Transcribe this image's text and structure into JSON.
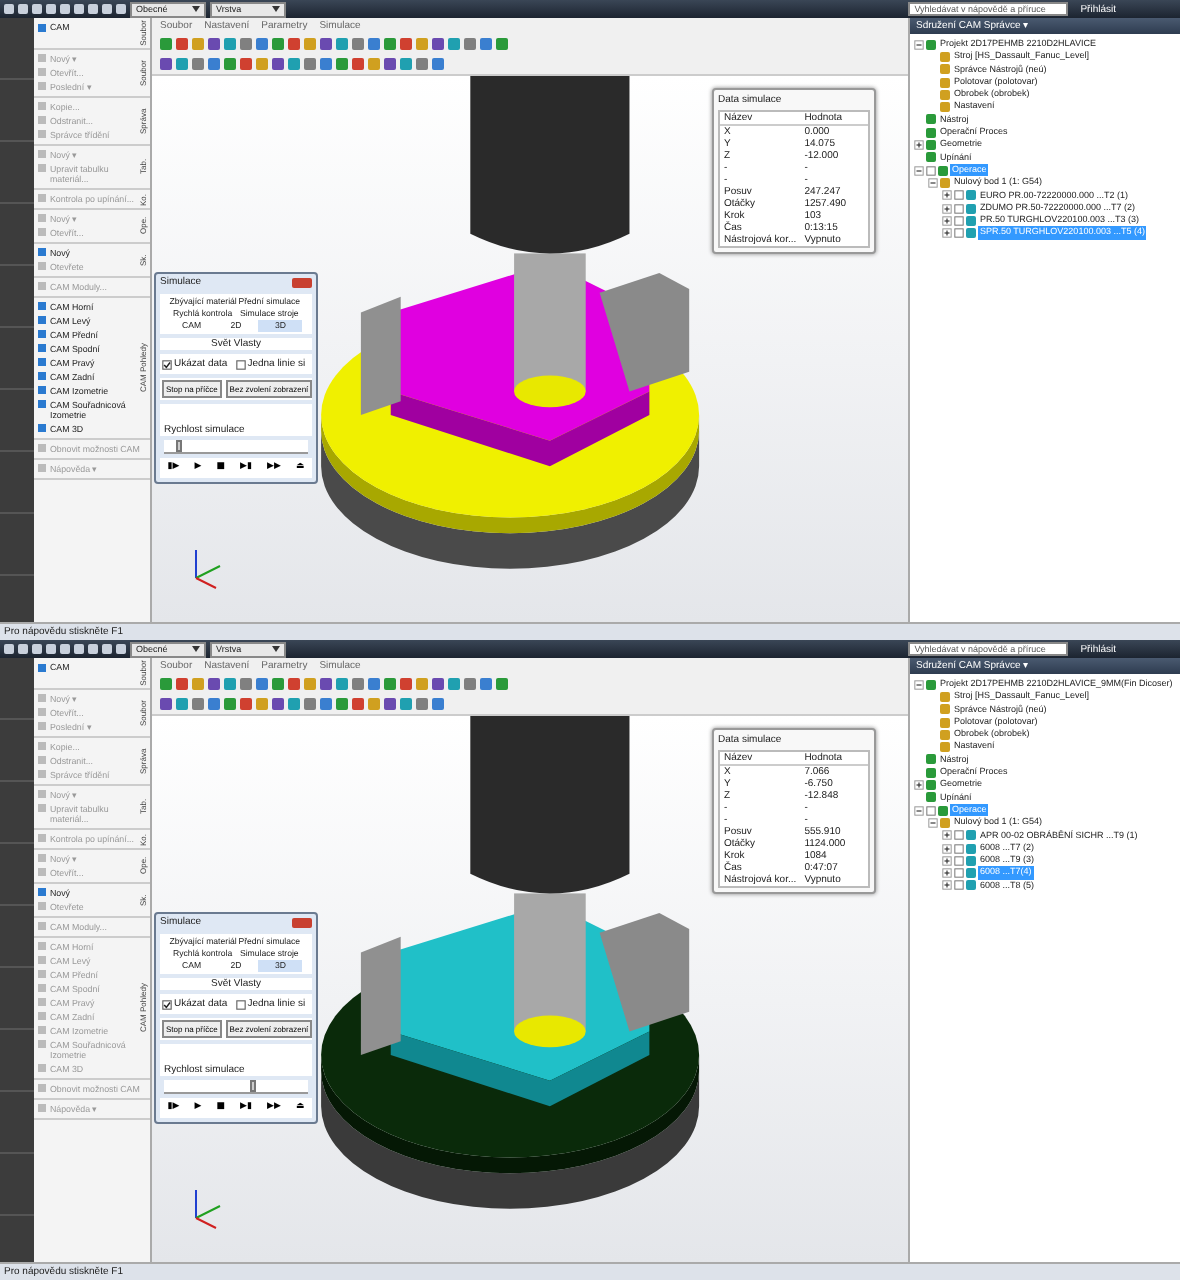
{
  "panes": [
    {
      "title_bar": {
        "search": {
          "placeholder": "Vyhledávat v nápovědě a příruce"
        },
        "sign_in": "Přihlásit",
        "dropdowns": [
          "Obecné",
          "Vrstva"
        ]
      },
      "ribbon": [
        {
          "label": "Soubor",
          "items": [
            {
              "label": "CAM",
              "disabled": false
            }
          ]
        },
        {
          "label": "Soubor",
          "items": [
            {
              "label": "Nový ▾",
              "disabled": true
            },
            {
              "label": "Otevřít...",
              "disabled": true
            },
            {
              "label": "Poslední ▾",
              "disabled": true
            }
          ]
        },
        {
          "label": "Správa",
          "items": [
            {
              "label": "Kopie...",
              "disabled": true
            },
            {
              "label": "Odstranit...",
              "disabled": true
            },
            {
              "label": "Správce třídění",
              "disabled": true
            }
          ]
        },
        {
          "label": "Tab.",
          "items": [
            {
              "label": "Nový ▾",
              "disabled": true
            },
            {
              "label": "Upravit tabulku materiál...",
              "disabled": true
            }
          ]
        },
        {
          "label": "Ko.",
          "items": [
            {
              "label": "Kontrola po upínání...",
              "disabled": true
            }
          ]
        },
        {
          "label": "Ope.",
          "items": [
            {
              "label": "Nový ▾",
              "disabled": true
            },
            {
              "label": "Otevřít...",
              "disabled": true
            }
          ]
        },
        {
          "label": "Sk.",
          "items": [
            {
              "label": "Nový",
              "disabled": false
            },
            {
              "label": "Otevřete",
              "disabled": true
            }
          ]
        },
        {
          "items": [
            {
              "label": "CAM Moduly...",
              "disabled": true
            }
          ]
        },
        {
          "label": "CAM Pohledy",
          "items": [
            {
              "label": "CAM Horní",
              "disabled": false
            },
            {
              "label": "CAM Levý",
              "disabled": false
            },
            {
              "label": "CAM Přední",
              "disabled": false
            },
            {
              "label": "CAM Spodní",
              "disabled": false
            },
            {
              "label": "CAM Pravý",
              "disabled": false
            },
            {
              "label": "CAM Zadní",
              "disabled": false
            },
            {
              "label": "CAM Izometrie",
              "disabled": false
            },
            {
              "label": "CAM Souřadnicová Izometrie",
              "disabled": false
            },
            {
              "label": "CAM 3D",
              "disabled": false
            }
          ]
        },
        {
          "items": [
            {
              "label": "Obnovit možnosti CAM",
              "disabled": true
            }
          ]
        },
        {
          "items": [
            {
              "label": "Nápověda ▾",
              "disabled": true
            }
          ]
        }
      ],
      "menu": [
        "Soubor",
        "Nastavení",
        "Parametry",
        "Simulace"
      ],
      "data_panel": {
        "title": "Data simulace",
        "columns": [
          "Název",
          "Hodnota"
        ],
        "rows": [
          [
            "X",
            "0.000"
          ],
          [
            "Y",
            "14.075"
          ],
          [
            "Z",
            "-12.000"
          ],
          [
            "-",
            "-"
          ],
          [
            "-",
            "-"
          ],
          [
            "Posuv",
            "247.247"
          ],
          [
            "Otáčky",
            "1257.490"
          ],
          [
            "Krok",
            "103"
          ],
          [
            "Čas",
            "0:13:15"
          ],
          [
            "Nástrojová kor...",
            "Vypnuto"
          ]
        ]
      },
      "simulation": {
        "title": "Simulace",
        "tabs": [
          {
            "label": "Zbývající materiál",
            "selected": false
          },
          {
            "label": "Přední simulace",
            "selected": false
          },
          {
            "label": "Rychlá kontrola",
            "selected": false
          },
          {
            "label": "Simulace stroje",
            "selected": false
          },
          {
            "label": "CAM",
            "selected": false
          },
          {
            "label": "2D",
            "selected": false
          },
          {
            "label": "3D",
            "selected": true
          }
        ],
        "subtitle": "Svět Vlasty",
        "options": [
          {
            "label": "Ukázat data",
            "checked": true
          },
          {
            "label": "Jedna linie si",
            "checked": false
          }
        ],
        "buttons": [
          "Stop na příčce",
          "Bez zvolení zobrazení"
        ],
        "speed_label": "Rychlost simulace",
        "speed": {
          "level": 0.08
        },
        "controls": [
          "▮▶",
          "▶",
          "■",
          "▶▮",
          "▶▶",
          "⏏"
        ]
      },
      "tree": {
        "title": "Sdružení CAM Správce ▾",
        "items": [
          {
            "label": "Projekt 2D17PEHMB 2210D2HLAVICE",
            "selected": false,
            "expanded": true,
            "children": [
              {
                "label": "Stroj [HS_Dassault_Fanuc_Level]",
                "selected": false
              },
              {
                "label": "Správce Nástrojů (neú)",
                "selected": false
              },
              {
                "label": "Polotovar (polotovar)",
                "selected": false
              },
              {
                "label": "Obrobek (obrobek)",
                "selected": false
              },
              {
                "label": "Nastavení",
                "selected": false
              }
            ]
          },
          {
            "label": "Nástroj",
            "selected": false
          },
          {
            "label": "Operační Proces",
            "selected": false
          },
          {
            "label": "Geometrie",
            "selected": false,
            "expanded": false
          },
          {
            "label": "Upínání",
            "selected": false
          },
          {
            "label": "Operace",
            "selected": true,
            "expanded": true,
            "checked": false,
            "children": [
              {
                "label": "Nulový bod 1 (1: G54)",
                "selected": false,
                "expanded": true,
                "children": [
                  {
                    "label": "EURO PR.00-72220000.000 ...T2 (1)",
                    "selected": false,
                    "expanded": false,
                    "checked": false
                  },
                  {
                    "label": "ZDUMO PR.50-72220000.000 ...T7 (2)",
                    "selected": false,
                    "expanded": false,
                    "checked": false
                  },
                  {
                    "label": "PR.50 TURGHLOV220100.003 ...T3 (3)",
                    "selected": false,
                    "expanded": false,
                    "checked": false
                  },
                  {
                    "label": "SPR.50 TURGHLOV220100.003 ...T5 (4)",
                    "selected": true,
                    "expanded": false,
                    "checked": false
                  }
                ]
              }
            ]
          }
        ]
      },
      "status_bar": "Pro nápovědu stiskněte F1"
    },
    {
      "title_bar": {
        "search": {
          "placeholder": "Vyhledávat v nápovědě a příruce"
        },
        "sign_in": "Přihlásit",
        "dropdowns": [
          "Obecné",
          "Vrstva"
        ]
      },
      "ribbon": [
        {
          "label": "Soubor",
          "items": [
            {
              "label": "CAM",
              "disabled": false
            }
          ]
        },
        {
          "label": "Soubor",
          "items": [
            {
              "label": "Nový ▾",
              "disabled": true
            },
            {
              "label": "Otevřít...",
              "disabled": true
            },
            {
              "label": "Poslední ▾",
              "disabled": true
            }
          ]
        },
        {
          "label": "Správa",
          "items": [
            {
              "label": "Kopie...",
              "disabled": true
            },
            {
              "label": "Odstranit...",
              "disabled": true
            },
            {
              "label": "Správce třídění",
              "disabled": true
            }
          ]
        },
        {
          "label": "Tab.",
          "items": [
            {
              "label": "Nový ▾",
              "disabled": true
            },
            {
              "label": "Upravit tabulku materiál...",
              "disabled": true
            }
          ]
        },
        {
          "label": "Ko.",
          "items": [
            {
              "label": "Kontrola po upínání...",
              "disabled": true
            }
          ]
        },
        {
          "label": "Ope.",
          "items": [
            {
              "label": "Nový ▾",
              "disabled": true
            },
            {
              "label": "Otevřít...",
              "disabled": true
            }
          ]
        },
        {
          "label": "Sk.",
          "items": [
            {
              "label": "Nový",
              "disabled": false
            },
            {
              "label": "Otevřete",
              "disabled": true
            }
          ]
        },
        {
          "items": [
            {
              "label": "CAM Moduly...",
              "disabled": true
            }
          ]
        },
        {
          "label": "CAM Pohledy",
          "items": [
            {
              "label": "CAM Horní",
              "disabled": true
            },
            {
              "label": "CAM Levý",
              "disabled": true
            },
            {
              "label": "CAM Přední",
              "disabled": true
            },
            {
              "label": "CAM Spodní",
              "disabled": true
            },
            {
              "label": "CAM Pravý",
              "disabled": true
            },
            {
              "label": "CAM Zadní",
              "disabled": true
            },
            {
              "label": "CAM Izometrie",
              "disabled": true
            },
            {
              "label": "CAM Souřadnicová Izometrie",
              "disabled": true
            },
            {
              "label": "CAM 3D",
              "disabled": true
            }
          ]
        },
        {
          "items": [
            {
              "label": "Obnovit možnosti CAM",
              "disabled": true
            }
          ]
        },
        {
          "items": [
            {
              "label": "Nápověda ▾",
              "disabled": true
            }
          ]
        }
      ],
      "menu": [
        "Soubor",
        "Nastavení",
        "Parametry",
        "Simulace"
      ],
      "data_panel": {
        "title": "Data simulace",
        "columns": [
          "Název",
          "Hodnota"
        ],
        "rows": [
          [
            "X",
            "7.066"
          ],
          [
            "Y",
            "-6.750"
          ],
          [
            "Z",
            "-12.848"
          ],
          [
            "-",
            "-"
          ],
          [
            "-",
            "-"
          ],
          [
            "Posuv",
            "555.910"
          ],
          [
            "Otáčky",
            "1124.000"
          ],
          [
            "Krok",
            "1084"
          ],
          [
            "Čas",
            "0:47:07"
          ],
          [
            "Nástrojová kor...",
            "Vypnuto"
          ]
        ]
      },
      "simulation": {
        "title": "Simulace",
        "tabs": [
          {
            "label": "Zbývající materiál",
            "selected": false
          },
          {
            "label": "Přední simulace",
            "selected": false
          },
          {
            "label": "Rychlá kontrola",
            "selected": false
          },
          {
            "label": "Simulace stroje",
            "selected": false
          },
          {
            "label": "CAM",
            "selected": false
          },
          {
            "label": "2D",
            "selected": false
          },
          {
            "label": "3D",
            "selected": true
          }
        ],
        "subtitle": "Svět Vlasty",
        "options": [
          {
            "label": "Ukázat data",
            "checked": true
          },
          {
            "label": "Jedna linie si",
            "checked": false
          }
        ],
        "buttons": [
          "Stop na příčce",
          "Bez zvolení zobrazení"
        ],
        "speed_label": "Rychlost simulace",
        "speed": {
          "level": 0.6
        },
        "controls": [
          "▮▶",
          "▶",
          "■",
          "▶▮",
          "▶▶",
          "⏏"
        ]
      },
      "tree": {
        "title": "Sdružení CAM Správce ▾",
        "items": [
          {
            "label": "Projekt 2D17PEHMB 2210D2HLAVICE_9MM(Fin Dicoser)",
            "selected": false,
            "expanded": true,
            "children": [
              {
                "label": "Stroj [HS_Dassault_Fanuc_Level]",
                "selected": false
              },
              {
                "label": "Správce Nástrojů (neú)",
                "selected": false
              },
              {
                "label": "Polotovar (polotovar)",
                "selected": false
              },
              {
                "label": "Obrobek (obrobek)",
                "selected": false
              },
              {
                "label": "Nastavení",
                "selected": false
              }
            ]
          },
          {
            "label": "Nástroj",
            "selected": false
          },
          {
            "label": "Operační Proces",
            "selected": false
          },
          {
            "label": "Geometrie",
            "selected": false,
            "expanded": false
          },
          {
            "label": "Upínání",
            "selected": false
          },
          {
            "label": "Operace",
            "selected": true,
            "expanded": true,
            "checked": false,
            "children": [
              {
                "label": "Nulový bod 1 (1: G54)",
                "selected": false,
                "expanded": true,
                "children": [
                  {
                    "label": "APR 00-02 OBRÁBĚNÍ SICHR ...T9 (1)",
                    "selected": false,
                    "expanded": false,
                    "checked": false
                  },
                  {
                    "label": "6008 ...T7 (2)",
                    "selected": false,
                    "expanded": false,
                    "checked": false
                  },
                  {
                    "label": "6008 ...T9 (3)",
                    "selected": false,
                    "expanded": false,
                    "checked": false
                  },
                  {
                    "label": "6008 ...T7(4)",
                    "selected": true,
                    "expanded": false,
                    "checked": false
                  },
                  {
                    "label": "6008 ...T8 (5)",
                    "selected": false,
                    "expanded": false,
                    "checked": false
                  }
                ]
              }
            ]
          }
        ]
      },
      "status_bar": "Pro nápovědu stiskněte F1"
    }
  ]
}
